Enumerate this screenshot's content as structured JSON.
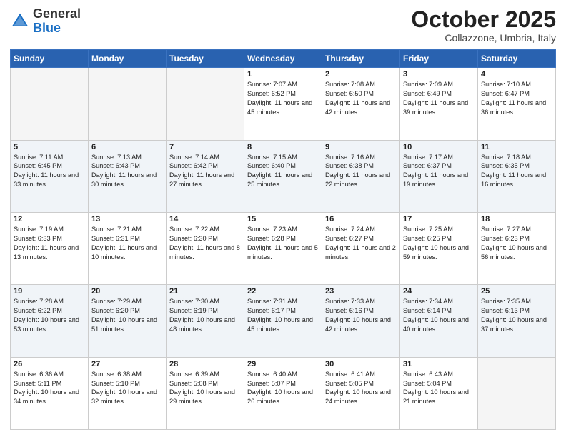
{
  "logo": {
    "general": "General",
    "blue": "Blue"
  },
  "header": {
    "month": "October 2025",
    "location": "Collazzone, Umbria, Italy"
  },
  "weekdays": [
    "Sunday",
    "Monday",
    "Tuesday",
    "Wednesday",
    "Thursday",
    "Friday",
    "Saturday"
  ],
  "weeks": [
    [
      {
        "day": "",
        "info": ""
      },
      {
        "day": "",
        "info": ""
      },
      {
        "day": "",
        "info": ""
      },
      {
        "day": "1",
        "info": "Sunrise: 7:07 AM\nSunset: 6:52 PM\nDaylight: 11 hours and 45 minutes."
      },
      {
        "day": "2",
        "info": "Sunrise: 7:08 AM\nSunset: 6:50 PM\nDaylight: 11 hours and 42 minutes."
      },
      {
        "day": "3",
        "info": "Sunrise: 7:09 AM\nSunset: 6:49 PM\nDaylight: 11 hours and 39 minutes."
      },
      {
        "day": "4",
        "info": "Sunrise: 7:10 AM\nSunset: 6:47 PM\nDaylight: 11 hours and 36 minutes."
      }
    ],
    [
      {
        "day": "5",
        "info": "Sunrise: 7:11 AM\nSunset: 6:45 PM\nDaylight: 11 hours and 33 minutes."
      },
      {
        "day": "6",
        "info": "Sunrise: 7:13 AM\nSunset: 6:43 PM\nDaylight: 11 hours and 30 minutes."
      },
      {
        "day": "7",
        "info": "Sunrise: 7:14 AM\nSunset: 6:42 PM\nDaylight: 11 hours and 27 minutes."
      },
      {
        "day": "8",
        "info": "Sunrise: 7:15 AM\nSunset: 6:40 PM\nDaylight: 11 hours and 25 minutes."
      },
      {
        "day": "9",
        "info": "Sunrise: 7:16 AM\nSunset: 6:38 PM\nDaylight: 11 hours and 22 minutes."
      },
      {
        "day": "10",
        "info": "Sunrise: 7:17 AM\nSunset: 6:37 PM\nDaylight: 11 hours and 19 minutes."
      },
      {
        "day": "11",
        "info": "Sunrise: 7:18 AM\nSunset: 6:35 PM\nDaylight: 11 hours and 16 minutes."
      }
    ],
    [
      {
        "day": "12",
        "info": "Sunrise: 7:19 AM\nSunset: 6:33 PM\nDaylight: 11 hours and 13 minutes."
      },
      {
        "day": "13",
        "info": "Sunrise: 7:21 AM\nSunset: 6:31 PM\nDaylight: 11 hours and 10 minutes."
      },
      {
        "day": "14",
        "info": "Sunrise: 7:22 AM\nSunset: 6:30 PM\nDaylight: 11 hours and 8 minutes."
      },
      {
        "day": "15",
        "info": "Sunrise: 7:23 AM\nSunset: 6:28 PM\nDaylight: 11 hours and 5 minutes."
      },
      {
        "day": "16",
        "info": "Sunrise: 7:24 AM\nSunset: 6:27 PM\nDaylight: 11 hours and 2 minutes."
      },
      {
        "day": "17",
        "info": "Sunrise: 7:25 AM\nSunset: 6:25 PM\nDaylight: 10 hours and 59 minutes."
      },
      {
        "day": "18",
        "info": "Sunrise: 7:27 AM\nSunset: 6:23 PM\nDaylight: 10 hours and 56 minutes."
      }
    ],
    [
      {
        "day": "19",
        "info": "Sunrise: 7:28 AM\nSunset: 6:22 PM\nDaylight: 10 hours and 53 minutes."
      },
      {
        "day": "20",
        "info": "Sunrise: 7:29 AM\nSunset: 6:20 PM\nDaylight: 10 hours and 51 minutes."
      },
      {
        "day": "21",
        "info": "Sunrise: 7:30 AM\nSunset: 6:19 PM\nDaylight: 10 hours and 48 minutes."
      },
      {
        "day": "22",
        "info": "Sunrise: 7:31 AM\nSunset: 6:17 PM\nDaylight: 10 hours and 45 minutes."
      },
      {
        "day": "23",
        "info": "Sunrise: 7:33 AM\nSunset: 6:16 PM\nDaylight: 10 hours and 42 minutes."
      },
      {
        "day": "24",
        "info": "Sunrise: 7:34 AM\nSunset: 6:14 PM\nDaylight: 10 hours and 40 minutes."
      },
      {
        "day": "25",
        "info": "Sunrise: 7:35 AM\nSunset: 6:13 PM\nDaylight: 10 hours and 37 minutes."
      }
    ],
    [
      {
        "day": "26",
        "info": "Sunrise: 6:36 AM\nSunset: 5:11 PM\nDaylight: 10 hours and 34 minutes."
      },
      {
        "day": "27",
        "info": "Sunrise: 6:38 AM\nSunset: 5:10 PM\nDaylight: 10 hours and 32 minutes."
      },
      {
        "day": "28",
        "info": "Sunrise: 6:39 AM\nSunset: 5:08 PM\nDaylight: 10 hours and 29 minutes."
      },
      {
        "day": "29",
        "info": "Sunrise: 6:40 AM\nSunset: 5:07 PM\nDaylight: 10 hours and 26 minutes."
      },
      {
        "day": "30",
        "info": "Sunrise: 6:41 AM\nSunset: 5:05 PM\nDaylight: 10 hours and 24 minutes."
      },
      {
        "day": "31",
        "info": "Sunrise: 6:43 AM\nSunset: 5:04 PM\nDaylight: 10 hours and 21 minutes."
      },
      {
        "day": "",
        "info": ""
      }
    ]
  ]
}
